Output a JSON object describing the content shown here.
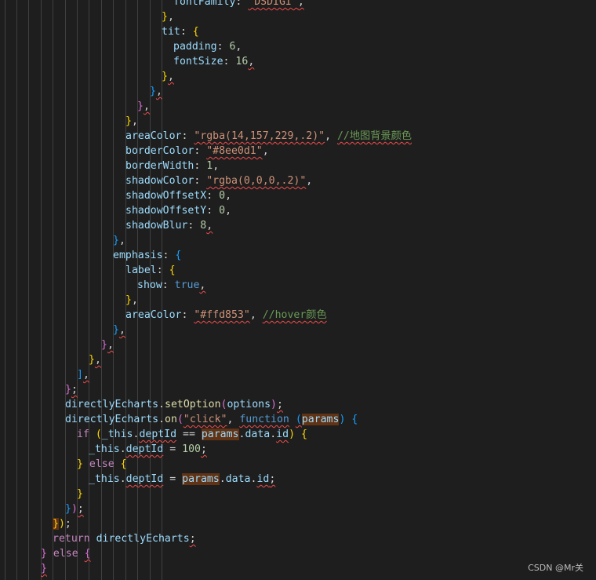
{
  "code_lines": [
    [
      {
        "t": "fontFamily",
        "k": "prop"
      },
      {
        "t": ": ",
        "k": "punc"
      },
      {
        "t": "\"DSDIGI\"",
        "k": "str",
        "w": 1
      },
      {
        "t": ",",
        "k": "punc",
        "w": 1
      }
    ],
    [
      {
        "t": "}",
        "k": "b1"
      },
      {
        "t": ",",
        "k": "punc"
      }
    ],
    [
      {
        "t": "tit",
        "k": "prop"
      },
      {
        "t": ": ",
        "k": "punc"
      },
      {
        "t": "{",
        "k": "b1"
      }
    ],
    [
      {
        "t": "padding",
        "k": "prop"
      },
      {
        "t": ": ",
        "k": "punc"
      },
      {
        "t": "6",
        "k": "num"
      },
      {
        "t": ",",
        "k": "punc"
      }
    ],
    [
      {
        "t": "fontSize",
        "k": "prop"
      },
      {
        "t": ": ",
        "k": "punc"
      },
      {
        "t": "16",
        "k": "num"
      },
      {
        "t": ",",
        "k": "punc",
        "w": 1
      }
    ],
    [
      {
        "t": "}",
        "k": "b1"
      },
      {
        "t": ",",
        "k": "punc",
        "w": 1
      }
    ],
    [
      {
        "t": "}",
        "k": "b3"
      },
      {
        "t": ",",
        "k": "punc",
        "w": 1
      }
    ],
    [
      {
        "t": "}",
        "k": "b2"
      },
      {
        "t": ",",
        "k": "punc",
        "w": 1
      }
    ],
    [
      {
        "t": "}",
        "k": "b1"
      },
      {
        "t": ",",
        "k": "punc"
      }
    ],
    [
      {
        "t": "areaColor",
        "k": "prop"
      },
      {
        "t": ": ",
        "k": "punc"
      },
      {
        "t": "\"rgba(14,157,229,.2)\"",
        "k": "str",
        "w": 1
      },
      {
        "t": ", ",
        "k": "punc"
      },
      {
        "t": "//地图背景颜色",
        "k": "comment",
        "w": 1
      }
    ],
    [
      {
        "t": "borderColor",
        "k": "prop"
      },
      {
        "t": ": ",
        "k": "punc"
      },
      {
        "t": "\"#8ee0d1\"",
        "k": "str",
        "w": 1
      },
      {
        "t": ",",
        "k": "punc"
      }
    ],
    [
      {
        "t": "borderWidth",
        "k": "prop"
      },
      {
        "t": ": ",
        "k": "punc"
      },
      {
        "t": "1",
        "k": "num"
      },
      {
        "t": ",",
        "k": "punc"
      }
    ],
    [
      {
        "t": "shadowColor",
        "k": "prop"
      },
      {
        "t": ": ",
        "k": "punc"
      },
      {
        "t": "\"rgba(0,0,0,.2)\"",
        "k": "str",
        "w": 1
      },
      {
        "t": ",",
        "k": "punc"
      }
    ],
    [
      {
        "t": "shadowOffsetX",
        "k": "prop"
      },
      {
        "t": ": ",
        "k": "punc"
      },
      {
        "t": "0",
        "k": "num"
      },
      {
        "t": ",",
        "k": "punc"
      }
    ],
    [
      {
        "t": "shadowOffsetY",
        "k": "prop"
      },
      {
        "t": ": ",
        "k": "punc"
      },
      {
        "t": "0",
        "k": "num"
      },
      {
        "t": ",",
        "k": "punc"
      }
    ],
    [
      {
        "t": "shadowBlur",
        "k": "prop"
      },
      {
        "t": ": ",
        "k": "punc"
      },
      {
        "t": "8",
        "k": "num"
      },
      {
        "t": ",",
        "k": "punc",
        "w": 1
      }
    ],
    [
      {
        "t": "}",
        "k": "b3"
      },
      {
        "t": ",",
        "k": "punc"
      }
    ],
    [
      {
        "t": "emphasis",
        "k": "prop"
      },
      {
        "t": ": ",
        "k": "punc"
      },
      {
        "t": "{",
        "k": "b3"
      }
    ],
    [
      {
        "t": "label",
        "k": "prop"
      },
      {
        "t": ": ",
        "k": "punc"
      },
      {
        "t": "{",
        "k": "b1"
      }
    ],
    [
      {
        "t": "show",
        "k": "prop"
      },
      {
        "t": ": ",
        "k": "punc"
      },
      {
        "t": "true",
        "k": "kw"
      },
      {
        "t": ",",
        "k": "punc",
        "w": 1
      }
    ],
    [
      {
        "t": "}",
        "k": "b1"
      },
      {
        "t": ",",
        "k": "punc"
      }
    ],
    [
      {
        "t": "areaColor",
        "k": "prop"
      },
      {
        "t": ": ",
        "k": "punc"
      },
      {
        "t": "\"#ffd853\"",
        "k": "str",
        "w": 1
      },
      {
        "t": ", ",
        "k": "punc"
      },
      {
        "t": "//hover颜色",
        "k": "comment",
        "w": 1
      }
    ],
    [
      {
        "t": "}",
        "k": "b3"
      },
      {
        "t": ",",
        "k": "punc",
        "w": 1
      }
    ],
    [
      {
        "t": "}",
        "k": "b2"
      },
      {
        "t": ",",
        "k": "punc",
        "w": 1
      }
    ],
    [
      {
        "t": "}",
        "k": "b1"
      },
      {
        "t": ",",
        "k": "punc",
        "w": 1
      }
    ],
    [
      {
        "t": "]",
        "k": "b3"
      },
      {
        "t": ",",
        "k": "punc",
        "w": 1
      }
    ],
    [
      {
        "t": "}",
        "k": "b2"
      },
      {
        "t": ";",
        "k": "punc",
        "w": 1
      }
    ],
    [
      {
        "t": "directlyEcharts",
        "k": "var"
      },
      {
        "t": ".",
        "k": "punc"
      },
      {
        "t": "setOption",
        "k": "fn"
      },
      {
        "t": "(",
        "k": "b2"
      },
      {
        "t": "options",
        "k": "var"
      },
      {
        "t": ")",
        "k": "b2"
      },
      {
        "t": ";",
        "k": "punc",
        "w": 1
      }
    ],
    [
      {
        "t": "directlyEcharts",
        "k": "var"
      },
      {
        "t": ".",
        "k": "punc"
      },
      {
        "t": "on",
        "k": "fn"
      },
      {
        "t": "(",
        "k": "b2"
      },
      {
        "t": "\"click\"",
        "k": "str",
        "w": 1
      },
      {
        "t": ", ",
        "k": "punc"
      },
      {
        "t": "function",
        "k": "kw",
        "w": 1
      },
      {
        "t": " ",
        "k": "punc"
      },
      {
        "t": "(",
        "k": "b3",
        "w": 1
      },
      {
        "t": "params",
        "k": "var",
        "h": 1
      },
      {
        "t": ")",
        "k": "b3"
      },
      {
        "t": " ",
        "k": "punc"
      },
      {
        "t": "{",
        "k": "b3"
      }
    ],
    [
      {
        "t": "if",
        "k": "ctl"
      },
      {
        "t": " ",
        "k": "punc"
      },
      {
        "t": "(",
        "k": "b1"
      },
      {
        "t": "_this",
        "k": "var"
      },
      {
        "t": ".",
        "k": "punc"
      },
      {
        "t": "deptId",
        "k": "var",
        "w": 1
      },
      {
        "t": " == ",
        "k": "punc"
      },
      {
        "t": "params",
        "k": "var",
        "h": 1
      },
      {
        "t": ".",
        "k": "punc"
      },
      {
        "t": "data",
        "k": "var"
      },
      {
        "t": ".",
        "k": "punc"
      },
      {
        "t": "id",
        "k": "var",
        "w": 1
      },
      {
        "t": ")",
        "k": "b1"
      },
      {
        "t": " ",
        "k": "punc"
      },
      {
        "t": "{",
        "k": "b1"
      }
    ],
    [
      {
        "t": "_this",
        "k": "var"
      },
      {
        "t": ".",
        "k": "punc"
      },
      {
        "t": "deptId",
        "k": "var",
        "w": 1
      },
      {
        "t": " = ",
        "k": "punc"
      },
      {
        "t": "100",
        "k": "num"
      },
      {
        "t": ";",
        "k": "punc",
        "w": 1
      }
    ],
    [
      {
        "t": "}",
        "k": "b1"
      },
      {
        "t": " ",
        "k": "punc"
      },
      {
        "t": "else",
        "k": "ctl"
      },
      {
        "t": " ",
        "k": "punc"
      },
      {
        "t": "{",
        "k": "b1"
      }
    ],
    [
      {
        "t": "_this",
        "k": "var"
      },
      {
        "t": ".",
        "k": "punc"
      },
      {
        "t": "deptId",
        "k": "var",
        "w": 1
      },
      {
        "t": " = ",
        "k": "punc"
      },
      {
        "t": "params",
        "k": "var",
        "h": 1
      },
      {
        "t": ".",
        "k": "punc"
      },
      {
        "t": "data",
        "k": "var"
      },
      {
        "t": ".",
        "k": "punc"
      },
      {
        "t": "id",
        "k": "var",
        "w": 1
      },
      {
        "t": ";",
        "k": "punc",
        "w": 1
      }
    ],
    [
      {
        "t": "}",
        "k": "b1"
      }
    ],
    [
      {
        "t": "}",
        "k": "b3"
      },
      {
        "t": ")",
        "k": "b2"
      },
      {
        "t": ";",
        "k": "punc",
        "w": 1
      }
    ],
    [
      {
        "t": "}",
        "k": "b1",
        "h": 1
      },
      {
        "t": ")",
        "k": "b1"
      },
      {
        "t": ";",
        "k": "punc"
      }
    ],
    [
      {
        "t": "return",
        "k": "ctl"
      },
      {
        "t": " ",
        "k": "punc"
      },
      {
        "t": "directlyEcharts",
        "k": "var"
      },
      {
        "t": ";",
        "k": "punc",
        "w": 1
      }
    ],
    [
      {
        "t": "}",
        "k": "b2"
      },
      {
        "t": " ",
        "k": "punc"
      },
      {
        "t": "else",
        "k": "ctl"
      },
      {
        "t": " ",
        "k": "punc"
      },
      {
        "t": "{",
        "k": "b2",
        "w": 1
      }
    ],
    [
      {
        "t": "}",
        "k": "b2",
        "w": 1
      }
    ]
  ],
  "watermark": "CSDN @Mr关"
}
